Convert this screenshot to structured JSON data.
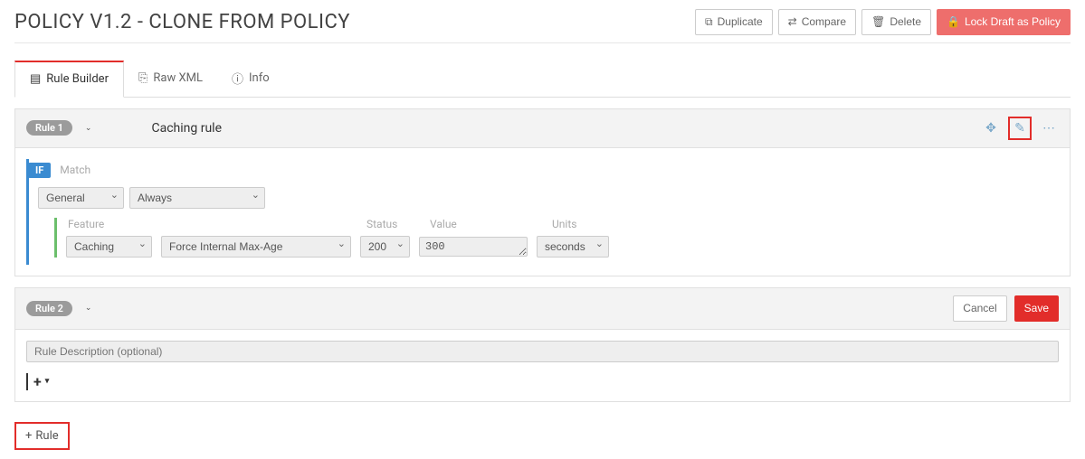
{
  "header": {
    "title": "POLICY V1.2 - CLONE FROM POLICY",
    "actions": {
      "duplicate": "Duplicate",
      "compare": "Compare",
      "delete": "Delete",
      "lock": "Lock Draft as Policy"
    }
  },
  "tabs": {
    "builder": "Rule Builder",
    "rawxml": "Raw XML",
    "info": "Info"
  },
  "rule1": {
    "badge": "Rule 1",
    "name": "Caching rule",
    "match_label": "Match",
    "if_label": "IF",
    "match_category": "General",
    "match_condition": "Always",
    "feature_label": "Feature",
    "status_label": "Status",
    "value_label": "Value",
    "units_label": "Units",
    "feature_category": "Caching",
    "feature_name": "Force Internal Max-Age",
    "status_value": "200",
    "value_value": "300",
    "units_value": "seconds"
  },
  "rule2": {
    "badge": "Rule 2",
    "cancel": "Cancel",
    "save": "Save",
    "desc_placeholder": "Rule Description (optional)"
  },
  "footer": {
    "add_rule": "Rule"
  }
}
